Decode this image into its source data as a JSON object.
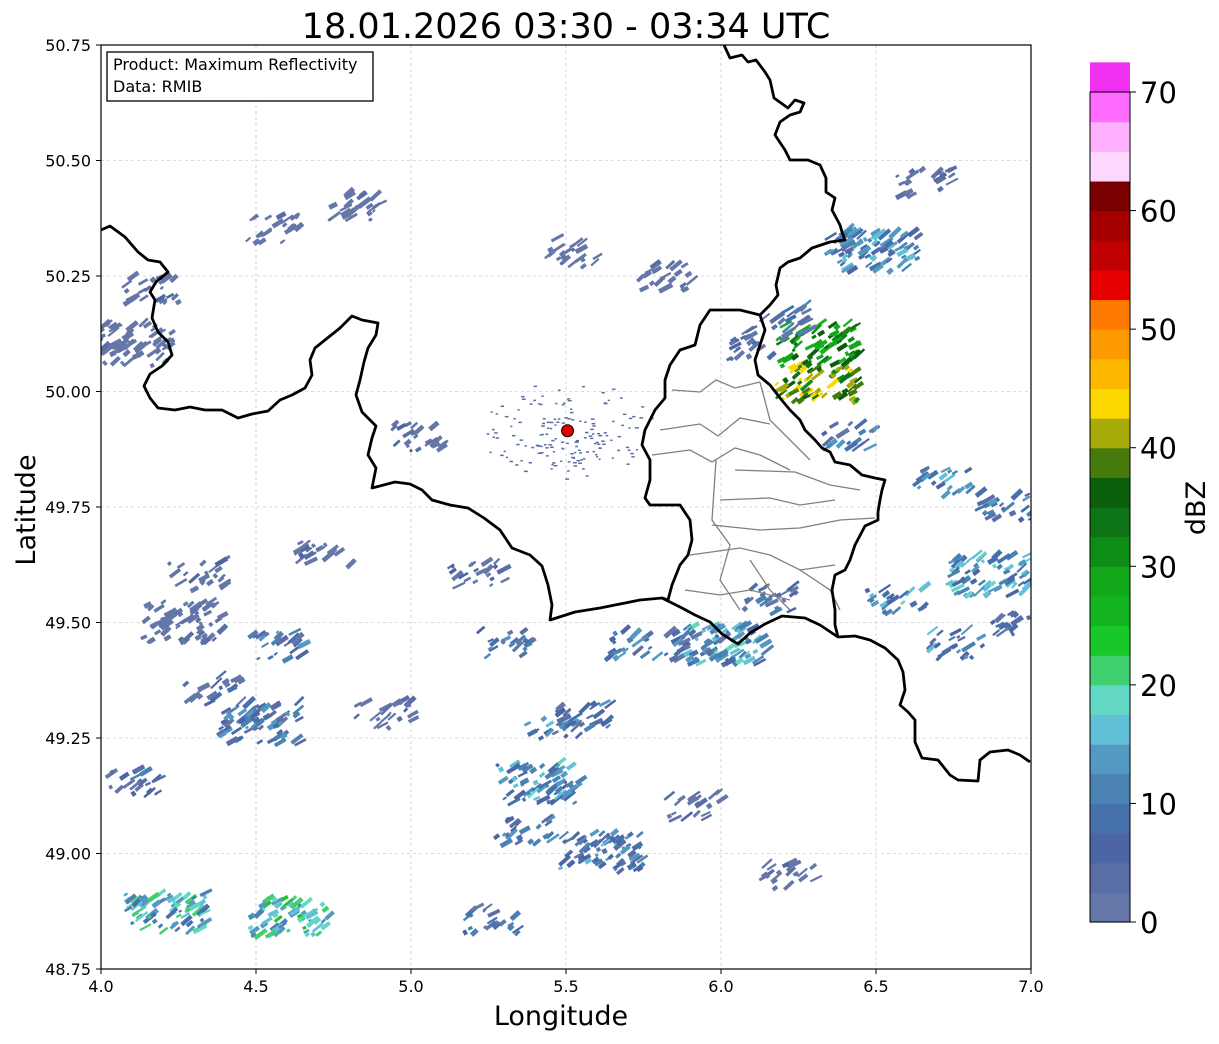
{
  "title": "18.01.2026 03:30 - 03:34 UTC",
  "info_box": {
    "product": "Product: Maximum Reflectivity",
    "data": "Data: RMIB"
  },
  "axes": {
    "xlabel": "Longitude",
    "ylabel": "Latitude",
    "x_ticks": [
      "4.0",
      "4.5",
      "5.0",
      "5.5",
      "6.0",
      "6.5",
      "7.0"
    ],
    "y_ticks": [
      "50.75",
      "50.50",
      "50.25",
      "50.00",
      "49.75",
      "49.50",
      "49.25",
      "49.00",
      "48.75"
    ],
    "xlim": [
      4.0,
      7.0
    ],
    "ylim": [
      48.75,
      50.75
    ],
    "grid": true
  },
  "radar_site": {
    "lon": 5.505,
    "lat": 49.915,
    "color": "#e00000"
  },
  "colorbar": {
    "label": "dBZ",
    "tick_labels": [
      "0",
      "10",
      "20",
      "30",
      "40",
      "50",
      "60",
      "70"
    ],
    "range": [
      0,
      70
    ],
    "step": 2.5,
    "colors": [
      "#6576a8",
      "#5a6ea6",
      "#4c66a4",
      "#4670ac",
      "#4a82b4",
      "#5499c2",
      "#62c0d8",
      "#62d8c4",
      "#40d070",
      "#18c828",
      "#14b41e",
      "#12a81a",
      "#0c8e16",
      "#0c7414",
      "#0a5e0c",
      "#467a0a",
      "#a8aa0a",
      "#fad800",
      "#fdb800",
      "#fd9a00",
      "#ff7a00",
      "#e60000",
      "#c00000",
      "#a40000",
      "#780000",
      "#ffd8ff",
      "#ffb0ff",
      "#ff6cff",
      "#f030f0"
    ]
  },
  "chart_data": {
    "type": "map",
    "title": "18.01.2026 03:30 - 03:34 UTC",
    "xlabel": "Longitude",
    "ylabel": "Latitude",
    "xlim": [
      4.0,
      7.0
    ],
    "ylim": [
      48.75,
      50.75
    ],
    "units": "dBZ",
    "echo_clusters": [
      {
        "lon": 4.2,
        "lat": 48.87,
        "dbz": 22
      },
      {
        "lon": 4.6,
        "lat": 48.86,
        "dbz": 24
      },
      {
        "lon": 4.5,
        "lat": 49.28,
        "dbz": 15
      },
      {
        "lon": 5.4,
        "lat": 49.15,
        "dbz": 18
      },
      {
        "lon": 5.6,
        "lat": 49.0,
        "dbz": 16
      },
      {
        "lon": 6.3,
        "lat": 50.02,
        "dbz": 45
      },
      {
        "lon": 6.3,
        "lat": 50.1,
        "dbz": 38
      },
      {
        "lon": 6.85,
        "lat": 49.6,
        "dbz": 20
      },
      {
        "lon": 6.5,
        "lat": 50.3,
        "dbz": 18
      },
      {
        "lon": 6.0,
        "lat": 49.45,
        "dbz": 20
      },
      {
        "lon": 4.25,
        "lat": 49.5,
        "dbz": 5
      },
      {
        "lon": 4.1,
        "lat": 50.1,
        "dbz": 3
      }
    ]
  }
}
